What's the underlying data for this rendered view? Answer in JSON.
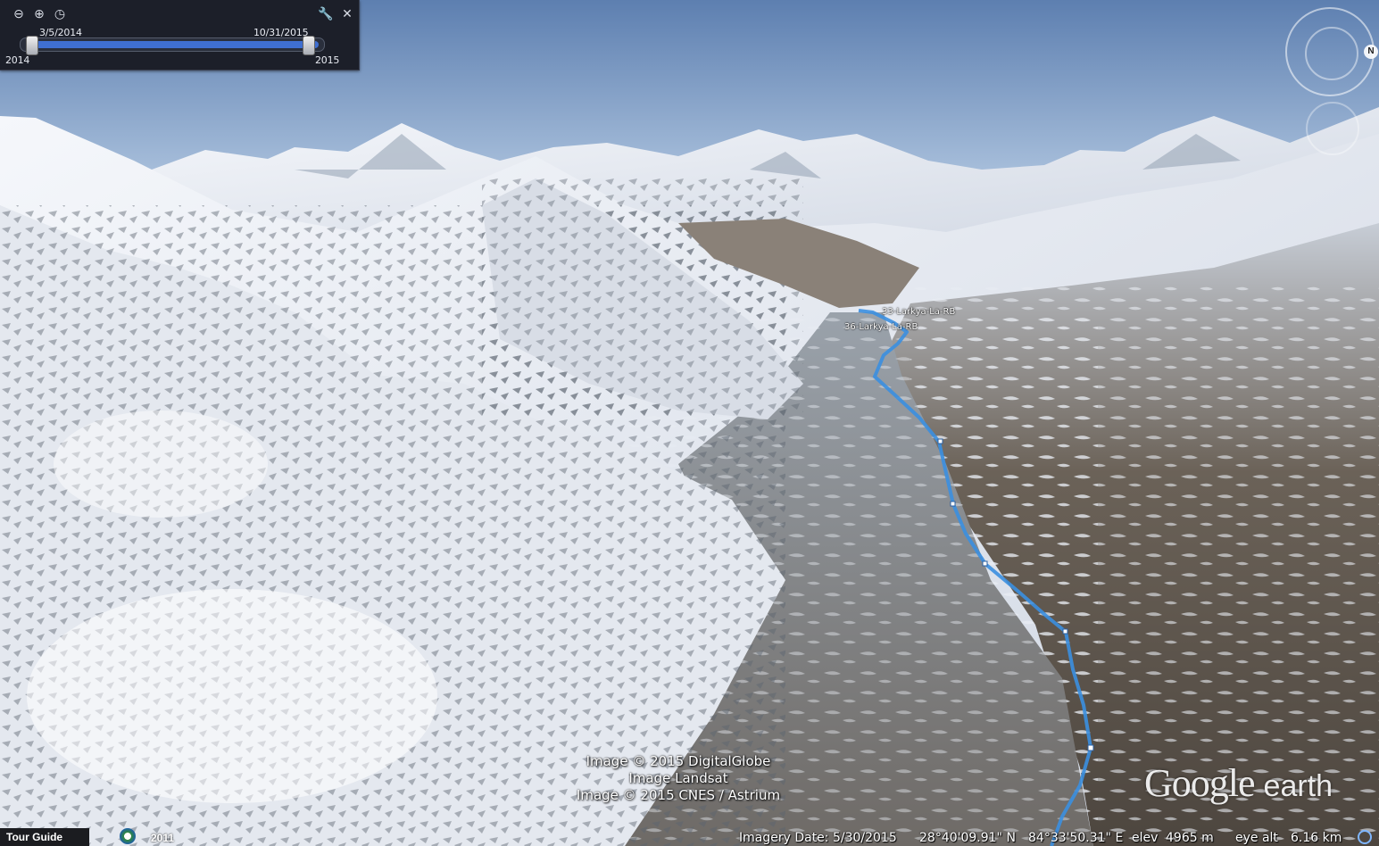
{
  "timeslider": {
    "start_label": "3/5/2014",
    "end_label": "10/31/2015",
    "min_year": "2014",
    "max_year": "2015"
  },
  "placemarks": [
    {
      "label": "33-Larkya-La-RB"
    },
    {
      "label": "36-Larkya-La-RB"
    }
  ],
  "attribution": {
    "line1": "Image © 2015 DigitalGlobe",
    "line2": "Image Landsat",
    "line3": "Image © 2015 CNES / Astrium"
  },
  "logo": {
    "text": "Google",
    "suffix": "earth"
  },
  "compass": {
    "north": "N"
  },
  "statusbar": {
    "tour_guide": "Tour Guide",
    "historical_year": "2011",
    "imagery_date": "Imagery Date: 5/30/2015",
    "latitude": "28°40'09.91\" N",
    "longitude": "84°33'50.31\" E",
    "elev_label": "elev",
    "elev_value": "4965 m",
    "eye_label": "eye alt",
    "eye_value": "6.16 km"
  },
  "colors": {
    "track": "#3b8fe0",
    "sky": "#6f8fb8",
    "snow": "#eef1f6"
  }
}
